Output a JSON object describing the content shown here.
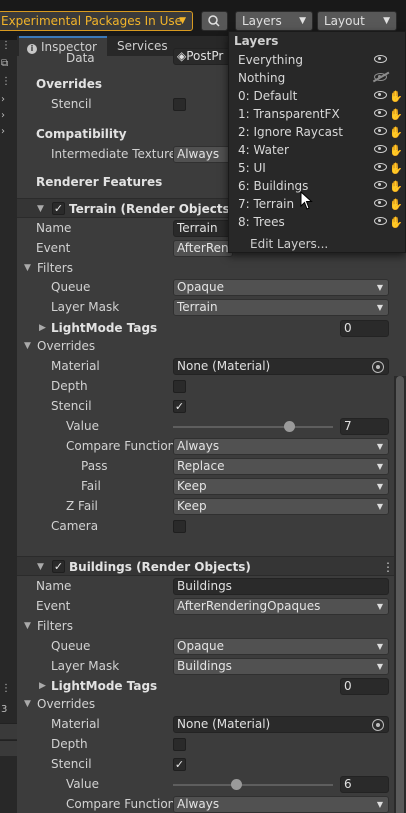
{
  "toolbar": {
    "experimental_label": "Experimental Packages In Use",
    "layers_label": "Layers",
    "layout_label": "Layout"
  },
  "tabs": {
    "inspector": "Inspector",
    "services": "Services"
  },
  "top_fields": {
    "data_label": "Data",
    "data_value": "PostPr",
    "overrides": "Overrides",
    "stencil": "Stencil",
    "compatibility": "Compatibility",
    "intermediate_texture": "Intermediate Texture",
    "intermediate_value": "Always",
    "renderer_features": "Renderer Features"
  },
  "terrain": {
    "header": "Terrain (Render Objects)",
    "name_label": "Name",
    "name_value": "Terrain",
    "event_label": "Event",
    "event_value": "AfterRen",
    "filters": "Filters",
    "queue_label": "Queue",
    "queue_value": "Opaque",
    "layer_mask_label": "Layer Mask",
    "layer_mask_value": "Terrain",
    "lightmode_label": "LightMode Tags",
    "lightmode_value": "0",
    "overrides": "Overrides",
    "material_label": "Material",
    "material_value": "None (Material)",
    "depth_label": "Depth",
    "stencil_label": "Stencil",
    "value_label": "Value",
    "value_value": "7",
    "value_fraction": 0.73,
    "compare_label": "Compare Function",
    "compare_value": "Always",
    "pass_label": "Pass",
    "pass_value": "Replace",
    "fail_label": "Fail",
    "fail_value": "Keep",
    "zfail_label": "Z Fail",
    "zfail_value": "Keep",
    "camera_label": "Camera"
  },
  "buildings": {
    "header": "Buildings (Render Objects)",
    "name_label": "Name",
    "name_value": "Buildings",
    "event_label": "Event",
    "event_value": "AfterRenderingOpaques",
    "filters": "Filters",
    "queue_label": "Queue",
    "queue_value": "Opaque",
    "layer_mask_label": "Layer Mask",
    "layer_mask_value": "Buildings",
    "lightmode_label": "LightMode Tags",
    "lightmode_value": "0",
    "overrides": "Overrides",
    "material_label": "Material",
    "material_value": "None (Material)",
    "depth_label": "Depth",
    "stencil_label": "Stencil",
    "value_label": "Value",
    "value_value": "6",
    "value_fraction": 0.4,
    "compare_label": "Compare Function",
    "compare_value": "Always"
  },
  "left_strip": {
    "number": "3"
  },
  "layers_popup": {
    "title": "Layers",
    "items": [
      {
        "name": "Everything",
        "visible": true
      },
      {
        "name": "Nothing",
        "visible": false
      },
      {
        "name": "0: Default",
        "visible": true
      },
      {
        "name": "1: TransparentFX",
        "visible": true
      },
      {
        "name": "2: Ignore Raycast",
        "visible": true
      },
      {
        "name": "4: Water",
        "visible": true
      },
      {
        "name": "5: UI",
        "visible": true
      },
      {
        "name": "6: Buildings",
        "visible": true
      },
      {
        "name": "7: Terrain",
        "visible": true
      },
      {
        "name": "8: Trees",
        "visible": true
      }
    ],
    "edit_label": "Edit Layers..."
  },
  "colors": {
    "accent_warning": "#f2b42a",
    "tab_accent": "#3a79bb"
  }
}
